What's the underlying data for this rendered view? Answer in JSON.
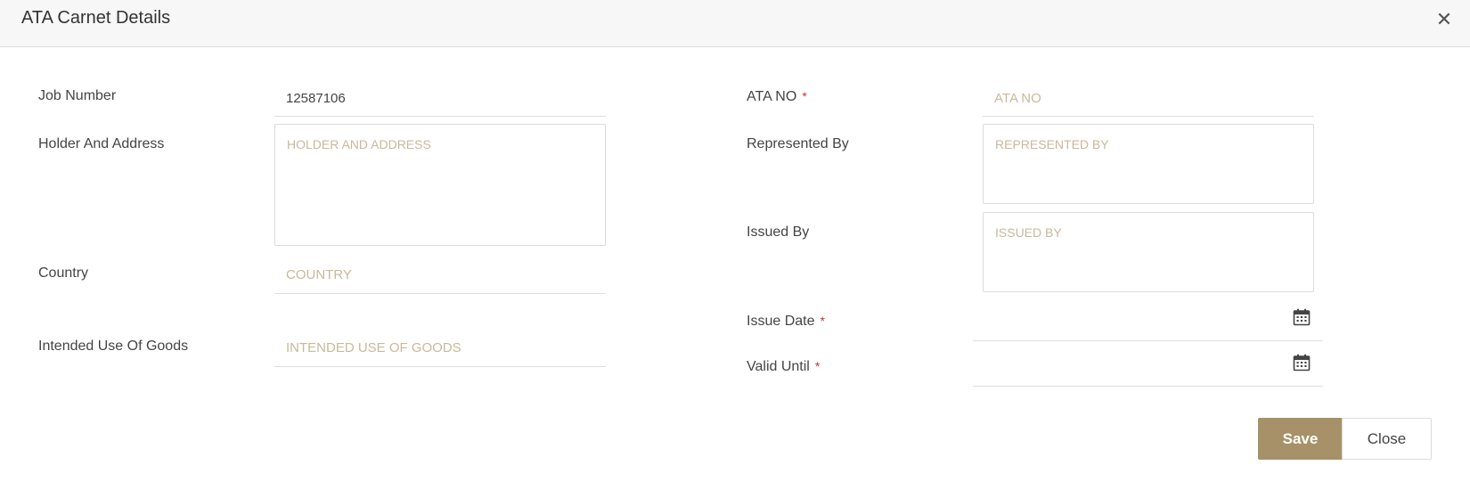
{
  "dialog": {
    "title": "ATA Carnet Details"
  },
  "left": {
    "job_number": {
      "label": "Job Number",
      "value": "12587106"
    },
    "holder_address": {
      "label": "Holder And Address",
      "placeholder": "HOLDER AND ADDRESS"
    },
    "country": {
      "label": "Country",
      "placeholder": "COUNTRY"
    },
    "intended_use": {
      "label": "Intended Use Of Goods",
      "placeholder": "INTENDED USE OF GOODS"
    }
  },
  "right": {
    "ata_no": {
      "label": "ATA NO",
      "placeholder": "ATA NO",
      "required_mark": "*"
    },
    "represented_by": {
      "label": "Represented By",
      "placeholder": "REPRESENTED BY"
    },
    "issued_by": {
      "label": "Issued By",
      "placeholder": "ISSUED BY"
    },
    "issue_date": {
      "label": "Issue Date",
      "value": "",
      "required_mark": "*"
    },
    "valid_until": {
      "label": "Valid Until",
      "value": "",
      "required_mark": "*"
    }
  },
  "footer": {
    "save_label": "Save",
    "close_label": "Close"
  },
  "icons": {
    "close": "close-icon",
    "calendar": "calendar-icon"
  },
  "colors": {
    "accent": "#a69168",
    "placeholder": "#c9b99a",
    "required": "#c0392b",
    "header_bg": "#f7f7f7"
  }
}
